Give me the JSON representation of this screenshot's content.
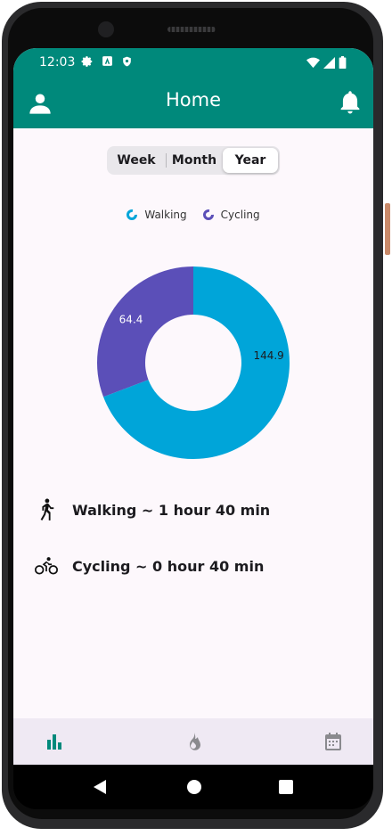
{
  "status": {
    "time": "12:03"
  },
  "appbar": {
    "title": "Home"
  },
  "period_selector": {
    "options": [
      "Week",
      "Month",
      "Year"
    ],
    "selected": "Year"
  },
  "legend": [
    {
      "label": "Walking",
      "color": "#00a5d9"
    },
    {
      "label": "Cycling",
      "color": "#5b4fb8"
    }
  ],
  "chart_data": {
    "type": "pie",
    "variant": "donut",
    "series": [
      {
        "name": "Walking",
        "value": 144.9,
        "color": "#00a5d9"
      },
      {
        "name": "Cycling",
        "value": 64.4,
        "color": "#5b4fb8"
      }
    ],
    "labels": [
      "144.9",
      "64.4"
    ]
  },
  "activities": [
    {
      "label": "Walking ~ 1 hour 40 min",
      "icon": "walking-icon"
    },
    {
      "label": "Cycling ~ 0 hour 40 min",
      "icon": "cycling-icon"
    }
  ],
  "bottom_nav": [
    {
      "icon": "bar-chart-icon",
      "active": true
    },
    {
      "icon": "fire-icon",
      "active": false
    },
    {
      "icon": "calendar-icon",
      "active": false
    }
  ]
}
